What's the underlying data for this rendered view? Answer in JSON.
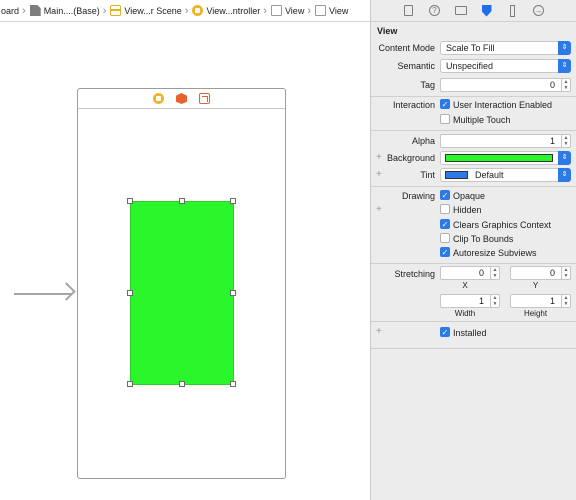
{
  "jumpbar": {
    "crumbs": [
      {
        "label": "oard",
        "icon": "storyboard-icon"
      },
      {
        "label": "Main....(Base)",
        "icon": "document-icon"
      },
      {
        "label": "View...r Scene",
        "icon": "scene-icon"
      },
      {
        "label": "View...ntroller",
        "icon": "view-controller-icon"
      },
      {
        "label": "View",
        "icon": "view-icon"
      },
      {
        "label": "View",
        "icon": "view-icon"
      }
    ]
  },
  "inspector": {
    "section_title": "View",
    "content_mode": {
      "label": "Content Mode",
      "value": "Scale To Fill"
    },
    "semantic": {
      "label": "Semantic",
      "value": "Unspecified"
    },
    "tag": {
      "label": "Tag",
      "value": "0"
    },
    "interaction": {
      "label": "Interaction",
      "user_interaction": {
        "label": "User Interaction Enabled",
        "checked": true
      },
      "multiple_touch": {
        "label": "Multiple Touch",
        "checked": false
      }
    },
    "alpha": {
      "label": "Alpha",
      "value": "1"
    },
    "background": {
      "label": "Background",
      "color": "#2bf52b"
    },
    "tint": {
      "label": "Tint",
      "value": "Default",
      "color": "#2d79e6"
    },
    "drawing": {
      "label": "Drawing",
      "opaque": {
        "label": "Opaque",
        "checked": true
      },
      "hidden": {
        "label": "Hidden",
        "checked": false
      },
      "clears": {
        "label": "Clears Graphics Context",
        "checked": true
      },
      "clip": {
        "label": "Clip To Bounds",
        "checked": false
      },
      "autoresize": {
        "label": "Autoresize Subviews",
        "checked": true
      }
    },
    "stretching": {
      "label": "Stretching",
      "x": {
        "value": "0",
        "label": "X"
      },
      "y": {
        "value": "0",
        "label": "Y"
      },
      "width": {
        "value": "1",
        "label": "Width"
      },
      "height": {
        "value": "1",
        "label": "Height"
      }
    },
    "installed": {
      "label": "Installed",
      "checked": true
    }
  },
  "colors": {
    "green_view": "#2bf52b",
    "accent": "#2d79e6"
  }
}
